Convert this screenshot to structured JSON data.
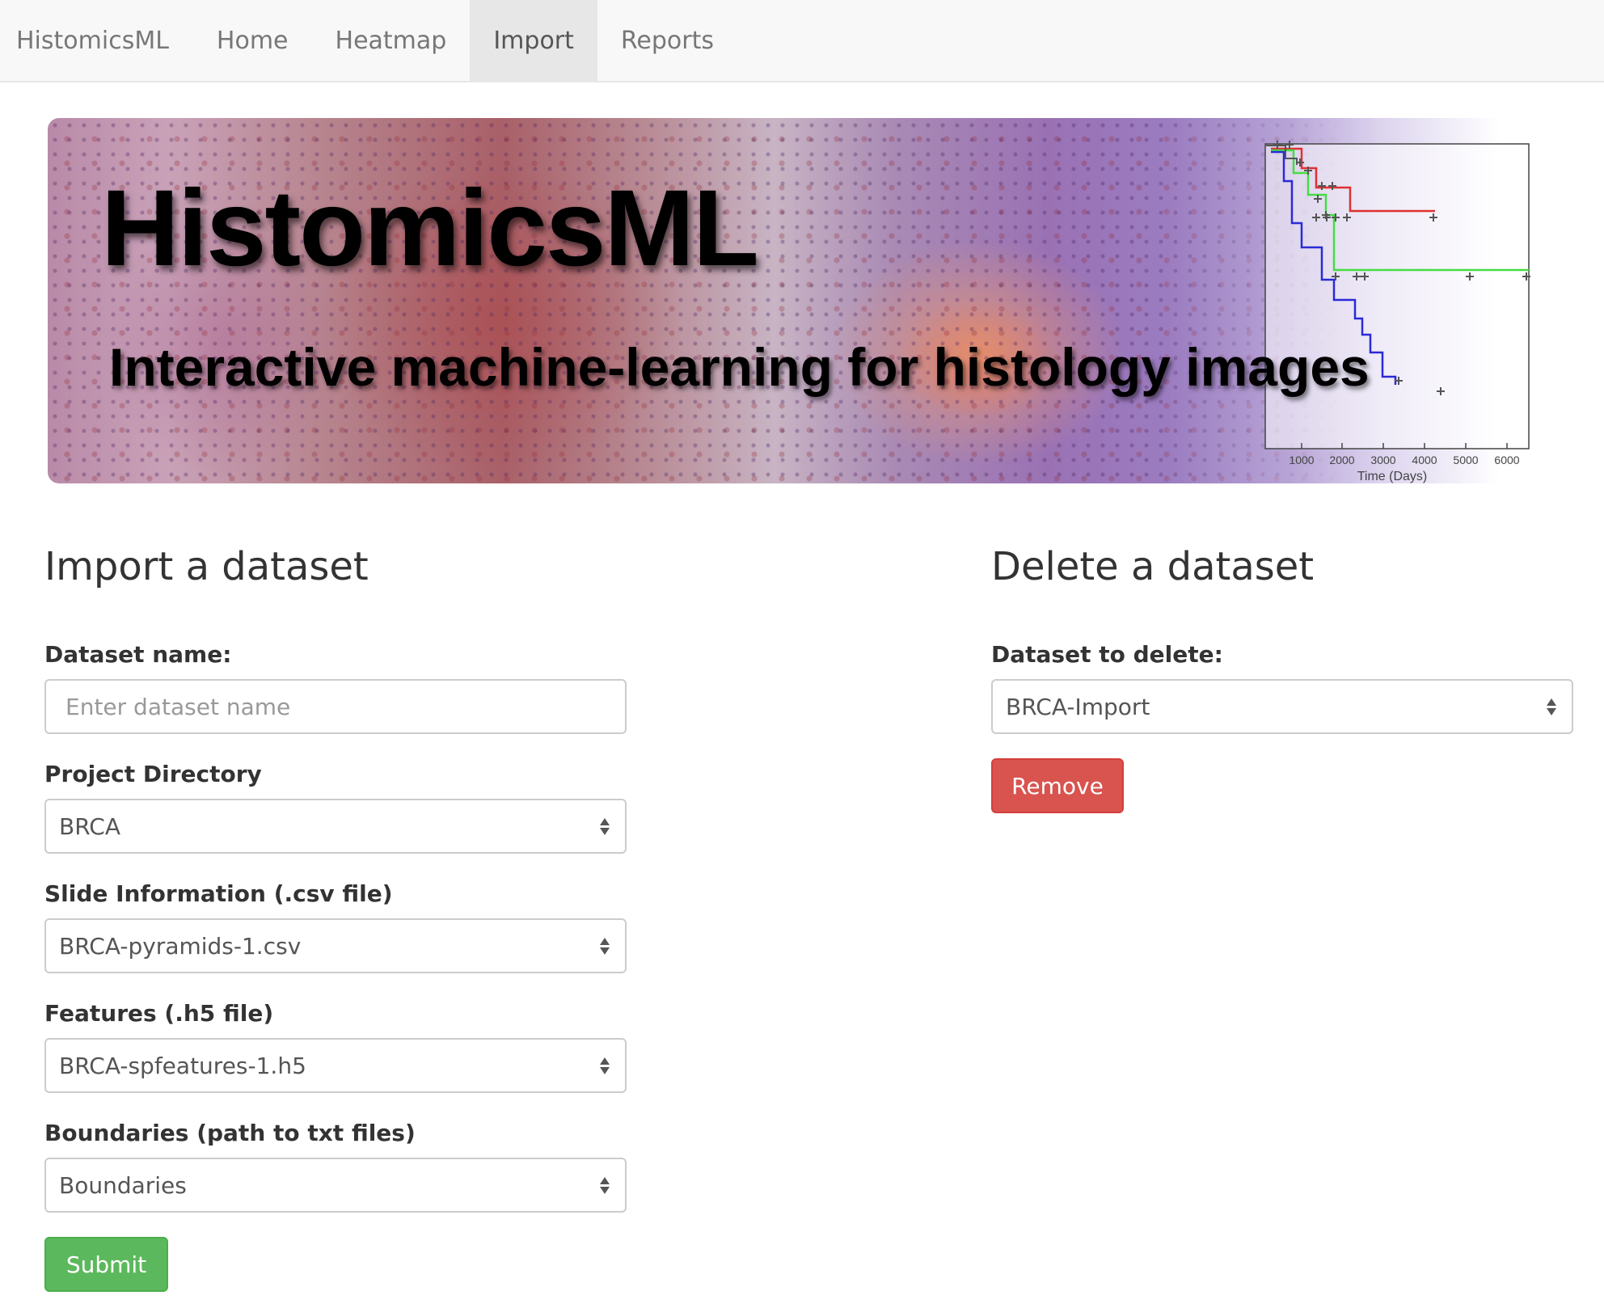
{
  "navbar": {
    "brand": "HistomicsML",
    "items": [
      {
        "label": "Home",
        "active": false
      },
      {
        "label": "Heatmap",
        "active": false
      },
      {
        "label": "Import",
        "active": true
      },
      {
        "label": "Reports",
        "active": false
      }
    ]
  },
  "banner": {
    "title": "HistomicsML",
    "subtitle": "Interactive machine-learning for histology images",
    "plot": {
      "xticks": [
        "1000",
        "2000",
        "3000",
        "4000",
        "5000",
        "6000"
      ],
      "xlabel": "Time (Days)",
      "series_colors": [
        "#e03030",
        "#44dd44",
        "#2a2ad8",
        "#555555"
      ]
    }
  },
  "import_panel": {
    "title": "Import a dataset",
    "dataset_name_label": "Dataset name:",
    "dataset_name_placeholder": "Enter dataset name",
    "dataset_name_value": "",
    "project_directory_label": "Project Directory",
    "project_directory_value": "BRCA",
    "slide_info_label": "Slide Information (.csv file)",
    "slide_info_value": "BRCA-pyramids-1.csv",
    "features_label": "Features (.h5 file)",
    "features_value": "BRCA-spfeatures-1.h5",
    "boundaries_label": "Boundaries (path to txt files)",
    "boundaries_value": "Boundaries",
    "submit_label": "Submit"
  },
  "delete_panel": {
    "title": "Delete a dataset",
    "dataset_label": "Dataset to delete:",
    "dataset_value": "BRCA-Import",
    "remove_label": "Remove"
  },
  "colors": {
    "navbar_bg": "#f8f8f8",
    "nav_active_bg": "#e7e7e7",
    "danger": "#d9534f",
    "success": "#5cb85c"
  }
}
